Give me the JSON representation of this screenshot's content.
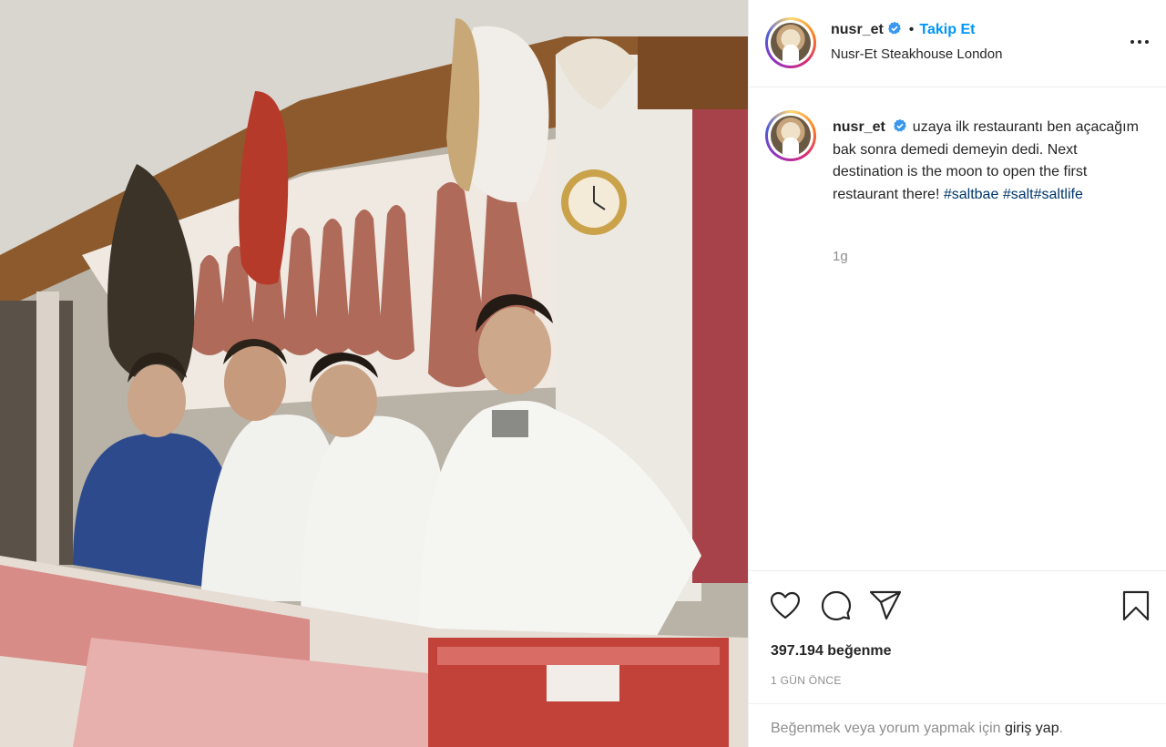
{
  "post": {
    "username": "nusr_et",
    "follow_label": "Takip Et",
    "separator": "•",
    "location": "Nusr-Et Steakhouse London",
    "caption_text": "uzaya ilk restaurantı ben açacağım bak sonra demedi demeyin dedi. Next destination is the moon to open the first restaurant there!",
    "hashtags": [
      "#saltbae",
      "#salt",
      "#saltlife"
    ],
    "comment_time": "1g",
    "likes": "397.194 beğenme",
    "posted_date": "1 GÜN ÖNCE",
    "login_prompt": "Beğenmek veya yorum yapmak için",
    "login_link": "giriş yap",
    "login_suffix": "."
  },
  "icons": {
    "verified": "verified-badge-icon",
    "more": "more-options-icon",
    "like": "heart-icon",
    "comment": "comment-bubble-icon",
    "share": "paper-plane-icon",
    "save": "bookmark-icon"
  },
  "colors": {
    "link_blue": "#0095f6",
    "hashtag": "#00376b",
    "muted": "#8e8e8e",
    "text": "#262626",
    "verified": "#3897f0"
  }
}
